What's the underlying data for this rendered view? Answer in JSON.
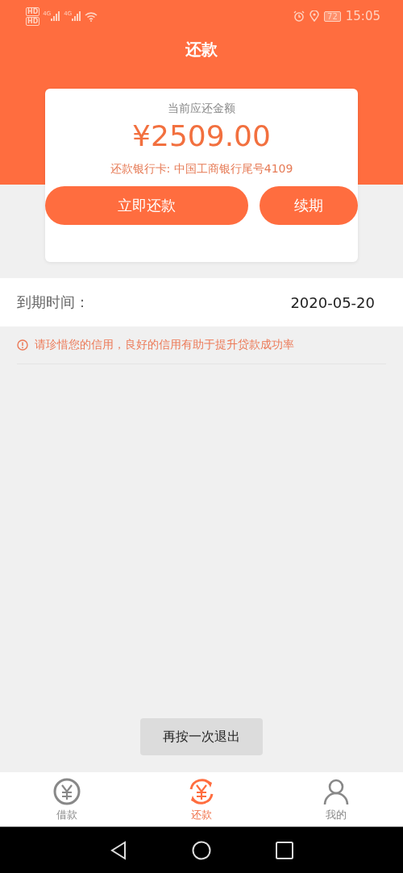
{
  "status_bar": {
    "sim": [
      {
        "badge": "HD",
        "network": "4G"
      },
      {
        "badge": "HD",
        "network": "4G"
      }
    ],
    "battery": "72",
    "time": "15:05"
  },
  "header": {
    "title": "还款"
  },
  "card": {
    "label": "当前应还金额",
    "amount": "¥2509.00",
    "bank_card": "还款银行卡: 中国工商银行尾号4109",
    "buttons": [
      "立即还款",
      "续期"
    ]
  },
  "due": {
    "label": "到期时间：",
    "value": "2020-05-20"
  },
  "notice": "请珍惜您的信用，良好的信用有助于提升贷款成功率",
  "toast": "再按一次退出",
  "tabs": [
    {
      "label": "借款",
      "kind": "yuan",
      "selected": false
    },
    {
      "label": "还款",
      "kind": "repay",
      "selected": true
    },
    {
      "label": "我的",
      "kind": "person",
      "selected": false
    }
  ]
}
